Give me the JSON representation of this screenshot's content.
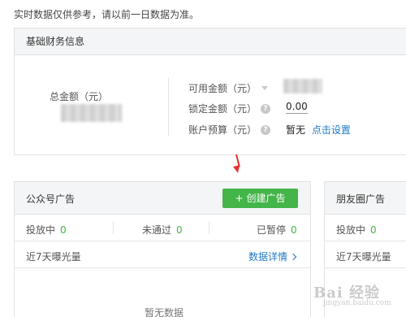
{
  "notice": "实时数据仅供参考，请以前一日数据为准。",
  "finance": {
    "header": "基础财务信息",
    "total_label": "总金额（元）",
    "available_label": "可用金额（元）",
    "locked_label": "锁定金额（元）",
    "locked_value": "0.00",
    "budget_label": "账户预算（元）",
    "budget_value": "暂无",
    "budget_link": "点击设置"
  },
  "gzh": {
    "title": "公众号广告",
    "create_button": "创建广告",
    "create_icon": "+",
    "stats": [
      {
        "label": "投放中",
        "value": "0"
      },
      {
        "label": "未通过",
        "value": "0"
      },
      {
        "label": "已暂停",
        "value": "0"
      }
    ],
    "exposure_label": "近7天曝光量",
    "details_link": "数据详情",
    "no_data": "暂无数据"
  },
  "pyq": {
    "title": "朋友圈广告",
    "stats": [
      {
        "label": "投放中",
        "value": "0"
      }
    ],
    "exposure_label": "近7天曝光量"
  },
  "watermark": {
    "text": "Bai 经验",
    "sub": "jingyan.baidu.com"
  },
  "colors": {
    "accent_green": "#44b549",
    "link_blue": "#1f78c8",
    "arrow_red": "#e8312b"
  }
}
